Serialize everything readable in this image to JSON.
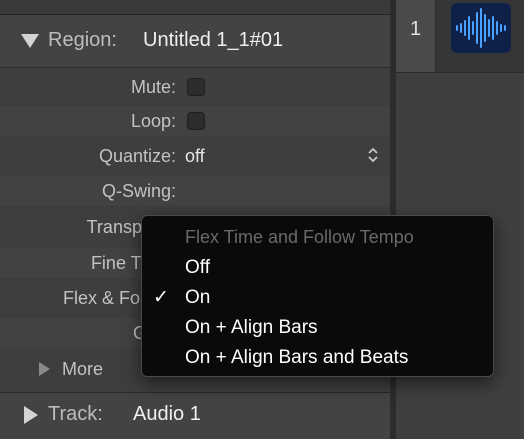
{
  "region": {
    "label": "Region:",
    "name": "Untitled 1_1#01"
  },
  "params": {
    "mute_label": "Mute:",
    "loop_label": "Loop:",
    "quantize_label": "Quantize:",
    "quantize_value": "off",
    "qswing_label": "Q-Swing:",
    "transpose_label": "Transpose:",
    "finetune_label": "Fine Tune:",
    "flex_label": "Flex & Follow:",
    "gain_label": "Gain:",
    "more_label": "More"
  },
  "track": {
    "label": "Track:",
    "name": "Audio 1",
    "number": "1"
  },
  "flex_menu": {
    "title": "Flex Time and Follow Tempo",
    "items": [
      {
        "label": "Off",
        "checked": false
      },
      {
        "label": "On",
        "checked": true
      },
      {
        "label": "On + Align Bars",
        "checked": false
      },
      {
        "label": "On + Align Bars and Beats",
        "checked": false
      }
    ],
    "check_glyph": "✓"
  },
  "colors": {
    "panel": "#3e3e3e",
    "menu_bg": "#0a0a0a",
    "audio_icon_bg": "#0f2148",
    "waveform": "#4aa0ff"
  }
}
